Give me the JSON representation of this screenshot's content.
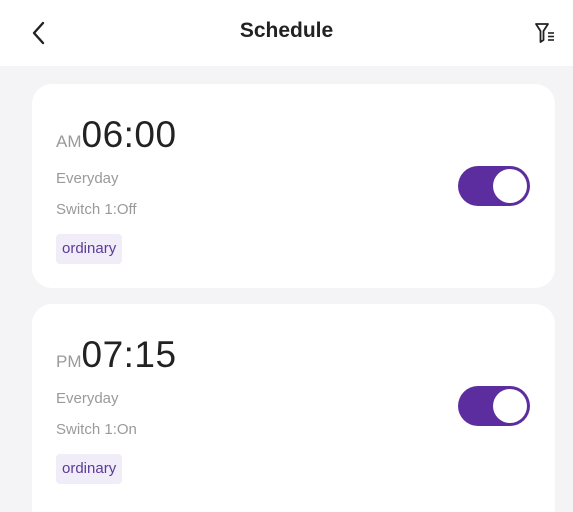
{
  "header": {
    "title": "Schedule",
    "back_icon": "chevron-left-icon",
    "filter_icon": "filter-icon"
  },
  "colors": {
    "accent": "#5b2d9e",
    "tag_bg": "#f0ecf8",
    "background": "#f4f4f6"
  },
  "schedules": [
    {
      "ampm": "AM",
      "time": "06:00",
      "repeat": "Everyday",
      "action": "Switch 1:Off",
      "tag": "ordinary",
      "enabled": true
    },
    {
      "ampm": "PM",
      "time": "07:15",
      "repeat": "Everyday",
      "action": "Switch 1:On",
      "tag": "ordinary",
      "enabled": true
    }
  ]
}
